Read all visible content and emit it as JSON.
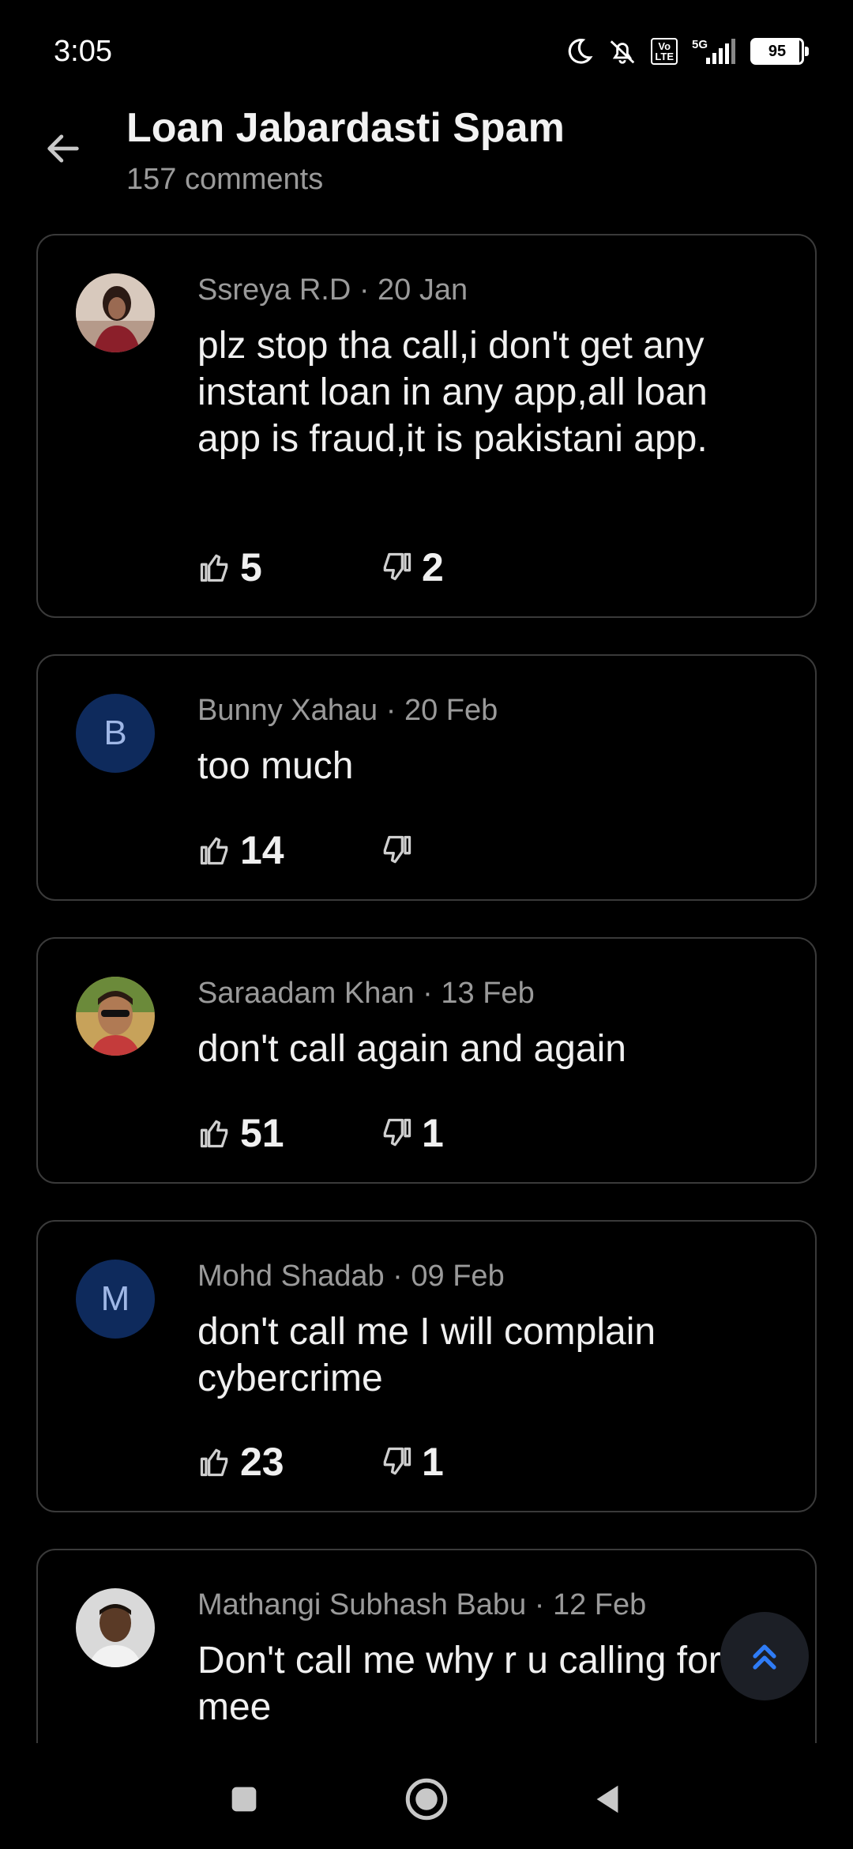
{
  "status_bar": {
    "time": "3:05",
    "icons": [
      "moon-icon",
      "alarm-off-icon",
      "volte-icon",
      "signal-5g-icon"
    ],
    "volte_label": "Vo\nLTE",
    "network": "5G",
    "battery": "95"
  },
  "header": {
    "title": "Loan Jabardasti Spam",
    "subtitle": "157 comments"
  },
  "comments": [
    {
      "author": "Ssreya R.D",
      "date": "20 Jan",
      "meta": "Ssreya R.D · 20 Jan",
      "text": "plz stop tha call,i don't get any instant loan in any app,all loan app is fraud,it is pakistani app.",
      "likes": "5",
      "dislikes": "2",
      "avatar": "photo"
    },
    {
      "author": "Bunny Xahau",
      "date": "20 Feb",
      "meta": "Bunny Xahau · 20 Feb",
      "text": "too much",
      "likes": "14",
      "dislikes": "",
      "avatar_letter": "B"
    },
    {
      "author": "Saraadam Khan",
      "date": "13 Feb",
      "meta": "Saraadam Khan · 13 Feb",
      "text": "don't call again and again",
      "likes": "51",
      "dislikes": "1",
      "avatar": "photo"
    },
    {
      "author": "Mohd Shadab",
      "date": "09 Feb",
      "meta": "Mohd Shadab · 09 Feb",
      "text": "don't call me I will complain cybercrime",
      "likes": "23",
      "dislikes": "1",
      "avatar_letter": "M"
    },
    {
      "author": "Mathangi Subhash Babu",
      "date": "12 Feb",
      "meta": "Mathangi Subhash Babu · 12 Feb",
      "text": "Don't call me why r u calling for mee",
      "avatar": "photo"
    }
  ],
  "icons": {
    "back": "arrow-left-icon",
    "like": "thumbs-up-icon",
    "dislike": "thumbs-down-icon",
    "scroll_top": "double-chevron-up-icon"
  },
  "colors": {
    "background": "#000000",
    "card_border": "#3a3a3a",
    "meta_text": "#9a9a9a",
    "avatar_letter_bg": "#0e2a5c",
    "fab_accent": "#2f7cf6"
  }
}
